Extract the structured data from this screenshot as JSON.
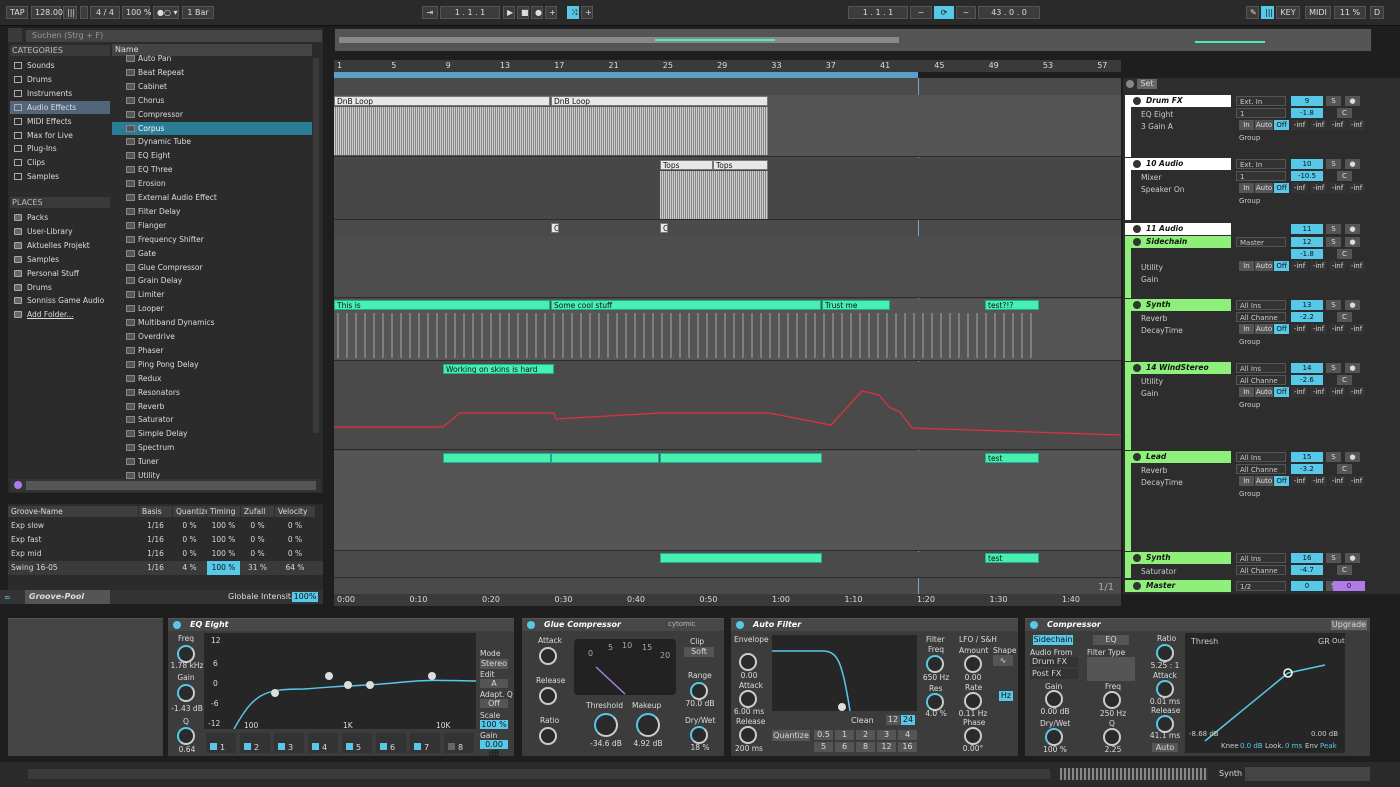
{
  "top": {
    "tap": "TAP",
    "bpm": "128.00",
    "sig": "4 / 4",
    "zoom": "100 %",
    "quant": "1 Bar",
    "pos": "1 . 1 . 1",
    "loop_start": "1 . 1 . 1",
    "loop_len": "43 . 0 . 0",
    "key": "KEY",
    "midi": "MIDI",
    "cpu": "11 %",
    "d": "D"
  },
  "browser": {
    "search_placeholder": "Suchen (Strg + F)",
    "categories_label": "CATEGORIES",
    "categories": [
      "Sounds",
      "Drums",
      "Instruments",
      "Audio Effects",
      "MIDI Effects",
      "Max for Live",
      "Plug-Ins",
      "Clips",
      "Samples"
    ],
    "places_label": "PLACES",
    "places": [
      "Packs",
      "User-Library",
      "Aktuelles Projekt",
      "Samples",
      "Personal Stuff",
      "Drums",
      "Sonniss Game Audio",
      "Add Folder..."
    ],
    "name_label": "Name",
    "items": [
      "Auto Pan",
      "Beat Repeat",
      "Cabinet",
      "Chorus",
      "Compressor",
      "Corpus",
      "Dynamic Tube",
      "EQ Eight",
      "EQ Three",
      "Erosion",
      "External Audio Effect",
      "Filter Delay",
      "Flanger",
      "Frequency Shifter",
      "Gate",
      "Glue Compressor",
      "Grain Delay",
      "Limiter",
      "Looper",
      "Multiband Dynamics",
      "Overdrive",
      "Phaser",
      "Ping Pong Delay",
      "Redux",
      "Resonators",
      "Reverb",
      "Saturator",
      "Simple Delay",
      "Spectrum",
      "Tuner",
      "Utility"
    ]
  },
  "groove": {
    "headers": [
      "Groove-Name",
      "Basis",
      "Quantize",
      "Timing",
      "Zufall",
      "Velocity"
    ],
    "rows": [
      [
        "Exp slow",
        "1/16",
        "0 %",
        "100 %",
        "0 %",
        "0 %"
      ],
      [
        "Exp fast",
        "1/16",
        "0 %",
        "100 %",
        "0 %",
        "0 %"
      ],
      [
        "Exp mid",
        "1/16",
        "0 %",
        "100 %",
        "0 %",
        "0 %"
      ],
      [
        "Swing 16-05",
        "1/16",
        "4 %",
        "100 %",
        "31 %",
        "64 %"
      ]
    ],
    "pool": "Groove-Pool",
    "global": "Globale Intensität",
    "global_val": "100%"
  },
  "ruler": [
    "1",
    "5",
    "9",
    "13",
    "17",
    "21",
    "25",
    "29",
    "33",
    "37",
    "41",
    "45",
    "49",
    "53",
    "57"
  ],
  "time": [
    "0:00",
    "0:10",
    "0:20",
    "0:30",
    "0:40",
    "0:50",
    "1:00",
    "1:10",
    "1:20",
    "1:30",
    "1:40"
  ],
  "clips": {
    "dnb1": "DnB Loop",
    "dnb2": "DnB Loop",
    "tops1": "Tops",
    "tops2": "Tops",
    "c1": "C",
    "c2": "C",
    "this": "This is",
    "cool": "Some cool stuff",
    "trust": "Trust me",
    "test1": "test?!?",
    "skins": "Working on skins is hard",
    "test2": "test",
    "test3": "test"
  },
  "page": "1/1",
  "mixer": {
    "set": "Set",
    "tracks": [
      {
        "name": "Drum FX",
        "devs": [
          "EQ Eight",
          "3 Gain A"
        ],
        "io": [
          "Ext. In",
          "1"
        ],
        "num": "9",
        "vol": "-1.8",
        "pan": "C",
        "grp": "Group"
      },
      {
        "name": "10 Audio",
        "devs": [
          "Mixer",
          "Speaker On"
        ],
        "io": [
          "Ext. In",
          "1"
        ],
        "num": "10",
        "vol": "-10.5",
        "pan": "C",
        "grp": "Group"
      },
      {
        "name": "11 Audio",
        "num": "11"
      },
      {
        "name": "Sidechain",
        "devs": [
          "Utility",
          "Gain"
        ],
        "io": [
          "Master"
        ],
        "num": "12",
        "vol": "-1.8",
        "pan": "C"
      },
      {
        "name": "Synth",
        "devs": [
          "Reverb",
          "DecayTime"
        ],
        "io": [
          "All Ins",
          "All Channe"
        ],
        "num": "13",
        "vol": "-2.2",
        "pan": "C",
        "grp": "Group"
      },
      {
        "name": "14 WindStereo",
        "devs": [
          "Utility",
          "Gain"
        ],
        "io": [
          "All Ins",
          "All Channe"
        ],
        "num": "14",
        "vol": "-2.6",
        "pan": "C",
        "grp": "Group"
      },
      {
        "name": "Lead",
        "devs": [
          "Reverb",
          "DecayTime"
        ],
        "io": [
          "All Ins",
          "All Channe"
        ],
        "num": "15",
        "vol": "-3.2",
        "pan": "C",
        "grp": "Group"
      },
      {
        "name": "Synth",
        "devs": [
          "Saturator"
        ],
        "io": [
          "All Ins",
          "All Channe"
        ],
        "num": "16",
        "vol": "-4.7",
        "pan": "C"
      },
      {
        "name": "Master",
        "io": [
          "1/2"
        ],
        "num": "0",
        "vol": "0"
      }
    ],
    "in": "In",
    "auto": "Auto",
    "off": "Off",
    "s": "S",
    "inf": "-inf"
  },
  "eq": {
    "title": "EQ Eight",
    "freq": "Freq",
    "freq_v": "1.78 kHz",
    "gain": "Gain",
    "gain_v": "-1.43 dB",
    "q": "Q",
    "q_v": "0.64",
    "mode": "Mode",
    "mode_v": "Stereo",
    "edit": "Edit",
    "edit_v": "A",
    "adapt": "Adapt. Q",
    "adapt_v": "Off",
    "scale": "Scale",
    "scale_v": "100 %",
    "gain2": "Gain",
    "gain2_v": "0.00 dB",
    "ticks": [
      "100",
      "1K",
      "10K"
    ],
    "db": [
      "12",
      "6",
      "0",
      "-6",
      "-12"
    ],
    "bands": [
      "1",
      "2",
      "3",
      "4",
      "5",
      "6",
      "7",
      "8"
    ]
  },
  "glue": {
    "title": "Glue Compressor",
    "brand": "cytomic",
    "attack": "Attack",
    "release": "Release",
    "ratio": "Ratio",
    "threshold": "Threshold",
    "thr_v": "-34.6 dB",
    "makeup": "Makeup",
    "mk_v": "4.92 dB",
    "range": "Range",
    "range_v": "70.0 dB",
    "drywet": "Dry/Wet",
    "dw_v": "18 %",
    "clip": "Clip",
    "soft": "Soft",
    "meter": [
      "0",
      "5",
      "10",
      "15",
      "20"
    ]
  },
  "af": {
    "title": "Auto Filter",
    "env": "Envelope",
    "env_v": "0.00",
    "att": "Attack",
    "att_v": "6.00 ms",
    "rel": "Release",
    "rel_v": "200 ms",
    "filter": "Filter",
    "freq": "Freq",
    "freq_v": "650 Hz",
    "res": "Res",
    "res_v": "4.0 %",
    "lfo": "LFO / S&H",
    "amount": "Amount",
    "amount_v": "0.00",
    "shape": "Shape",
    "rate": "Rate",
    "rate_v": "0.11 Hz",
    "phase": "Phase",
    "phase_v": "0.00°",
    "clean": "Clean",
    "quant": "Quantize",
    "qv": [
      "0.5",
      "1",
      "2",
      "3",
      "4",
      "5",
      "6",
      "8",
      "12",
      "16"
    ],
    "n12": "12",
    "n24": "24",
    "hz": "Hz"
  },
  "comp": {
    "title": "Compressor",
    "upgrade": "Upgrade",
    "sidechain": "Sidechain",
    "eq": "EQ",
    "audio_from": "Audio From",
    "src": "Drum FX",
    "post": "Post FX",
    "gain": "Gain",
    "gain_v": "0.00 dB",
    "dw": "Dry/Wet",
    "dw_v": "100 %",
    "ftype": "Filter Type",
    "freq": "Freq",
    "freq_v": "250 Hz",
    "q": "Q",
    "q_v": "2.25",
    "ratio": "Ratio",
    "ratio_v": "5.25 : 1",
    "attack": "Attack",
    "att_v": "0.01 ms",
    "release": "Release",
    "rel_v": "41.1 ms",
    "auto": "Auto",
    "thresh": "Thresh",
    "gr": "GR",
    "out": "Out",
    "th_v": "-8.68 dB",
    "out_v": "0.00 dB",
    "knee": "Knee",
    "knee_v": "0.0 dB",
    "look": "Look.",
    "look_v": "0 ms",
    "envl": "Env",
    "env_v": "Peak"
  },
  "status": {
    "track": "Synth"
  }
}
